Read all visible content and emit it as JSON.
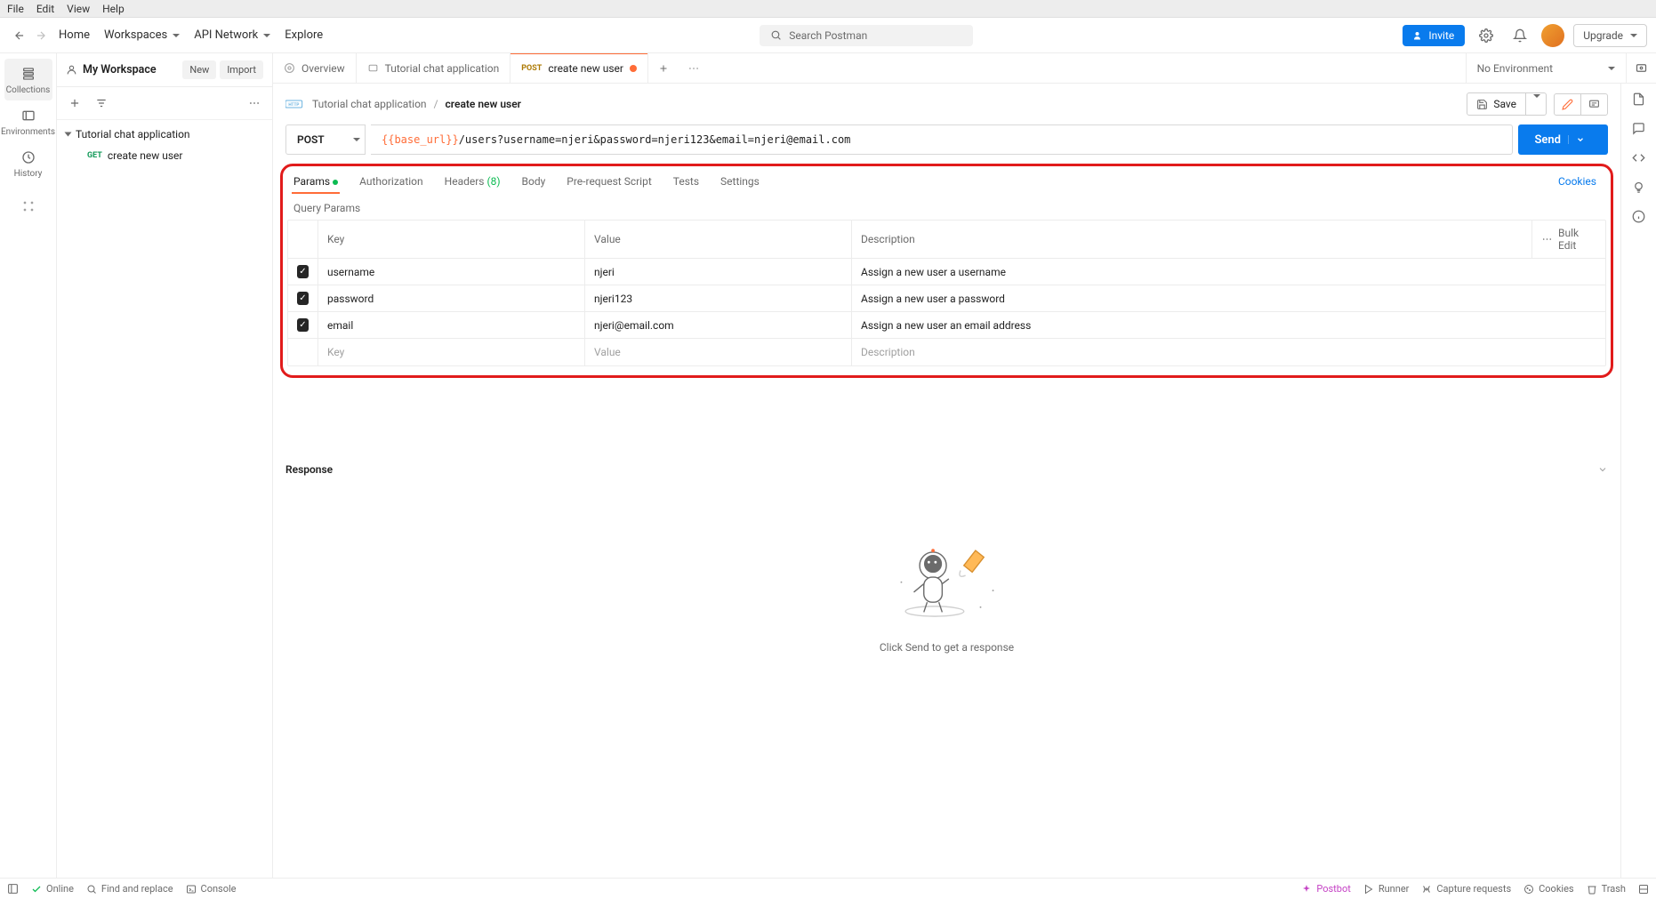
{
  "menubar": {
    "file": "File",
    "edit": "Edit",
    "view": "View",
    "help": "Help"
  },
  "header": {
    "home": "Home",
    "workspaces": "Workspaces",
    "api_network": "API Network",
    "explore": "Explore",
    "search_placeholder": "Search Postman",
    "invite": "Invite",
    "upgrade": "Upgrade"
  },
  "leftrail": {
    "collections": "Collections",
    "environments": "Environments",
    "history": "History"
  },
  "sidebar": {
    "workspace": "My Workspace",
    "new": "New",
    "import": "Import",
    "collection": "Tutorial chat application",
    "request_method": "GET",
    "request_name": "create new user"
  },
  "tabs": {
    "overview": "Overview",
    "collection_tab": "Tutorial chat application",
    "active_method": "POST",
    "active_name": "create new user",
    "no_env": "No Environment"
  },
  "crumb": {
    "collection": "Tutorial chat application",
    "request": "create new user",
    "save": "Save"
  },
  "url": {
    "method": "POST",
    "variable": "{{base_url}}",
    "path": "/users?username=njeri&password=njeri123&email=njeri@email.com",
    "send": "Send"
  },
  "req_tabs": {
    "params": "Params",
    "auth": "Authorization",
    "headers": "Headers",
    "headers_count": "(8)",
    "body": "Body",
    "prereq": "Pre-request Script",
    "tests": "Tests",
    "settings": "Settings",
    "cookies": "Cookies"
  },
  "params": {
    "section_label": "Query Params",
    "headers": {
      "key": "Key",
      "value": "Value",
      "description": "Description",
      "bulk_edit": "Bulk Edit"
    },
    "rows": [
      {
        "key": "username",
        "value": "njeri",
        "description": "Assign a new user a username"
      },
      {
        "key": "password",
        "value": "njeri123",
        "description": "Assign a new user a password"
      },
      {
        "key": "email",
        "value": "njeri@email.com",
        "description": "Assign a new user an email address"
      }
    ],
    "placeholders": {
      "key": "Key",
      "value": "Value",
      "description": "Description"
    }
  },
  "response": {
    "title": "Response",
    "empty_text": "Click Send to get a response"
  },
  "footer": {
    "online": "Online",
    "find": "Find and replace",
    "console": "Console",
    "postbot": "Postbot",
    "runner": "Runner",
    "capture": "Capture requests",
    "cookies": "Cookies",
    "trash": "Trash"
  }
}
